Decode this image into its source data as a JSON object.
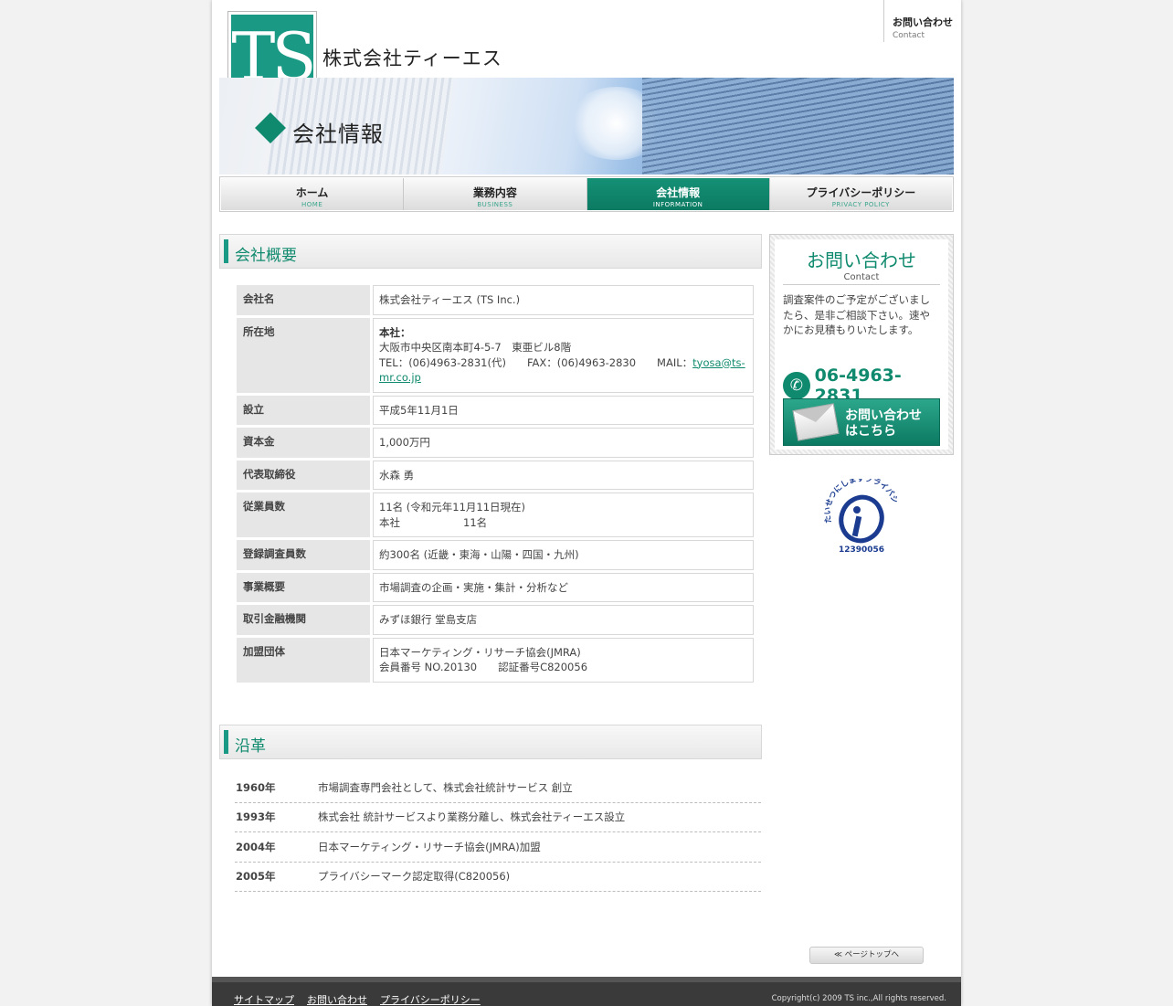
{
  "header": {
    "logo_text": "TS",
    "company_name": "株式会社ティーエス",
    "contact_jp": "お問い合わせ",
    "contact_en": "Contact"
  },
  "banner": {
    "title": "会社情報"
  },
  "nav": [
    {
      "jp": "ホーム",
      "en": "HOME",
      "active": false
    },
    {
      "jp": "業務内容",
      "en": "BUSINESS",
      "active": false
    },
    {
      "jp": "会社情報",
      "en": "INFORMATION",
      "active": true
    },
    {
      "jp": "プライバシーポリシー",
      "en": "PRIVACY POLICY",
      "active": false
    }
  ],
  "overview": {
    "heading": "会社概要",
    "rows": {
      "name": {
        "label": "会社名",
        "value": "株式会社ティーエス (TS Inc.)"
      },
      "address": {
        "label": "所在地",
        "head_office": "本社：",
        "addr": "大阪市中央区南本町4-5-7　東亜ビル8階",
        "tel_fax": "TEL：(06)4963-2831(代)　　FAX：(06)4963-2830　　MAIL：",
        "mail": "tyosa@ts-mr.co.jp"
      },
      "founded": {
        "label": "設立",
        "value": "平成5年11月1日"
      },
      "capital": {
        "label": "資本金",
        "value": "1,000万円"
      },
      "ceo": {
        "label": "代表取締役",
        "value": "水森 勇"
      },
      "employees": {
        "label": "従業員数",
        "line1": "11名 (令和元年11月11日現在)",
        "line2": "本社　　　　　　11名"
      },
      "researchers": {
        "label": "登録調査員数",
        "value": "約300名 (近畿・東海・山陽・四国・九州)"
      },
      "business": {
        "label": "事業概要",
        "value": "市場調査の企画・実施・集計・分析など"
      },
      "bank": {
        "label": "取引金融機関",
        "value": "みずほ銀行 堂島支店"
      },
      "member": {
        "label": "加盟団体",
        "line1": "日本マーケティング・リサーチ協会(JMRA)",
        "line2": "会員番号 NO.20130　　認証番号C820056"
      }
    }
  },
  "history": {
    "heading": "沿革",
    "rows": [
      {
        "year": "1960年",
        "event": "市場調査専門会社として、株式会社統計サービス 創立"
      },
      {
        "year": "1993年",
        "event": "株式会社 統計サービスより業務分離し、株式会社ティーエス設立"
      },
      {
        "year": "2004年",
        "event": "日本マーケティング・リサーチ協会(JMRA)加盟"
      },
      {
        "year": "2005年",
        "event": "プライバシーマーク認定取得(C820056)"
      }
    ]
  },
  "sidebar": {
    "title": "お問い合わせ",
    "title_en": "Contact",
    "message": "調査案件のご予定がございましたら、是非ご相談下さい。速やかにお見積もりいたします。",
    "phone": "06-4963-2831",
    "button_line1": "お問い合わせ",
    "button_line2": "はこちら",
    "pmark_text": "たいせつにしますプライバシー",
    "pmark_code": "12390056"
  },
  "pagetop": "≪ ページトップへ",
  "footer": {
    "links": [
      "サイトマップ",
      "お問い合わせ",
      "プライバシーポリシー"
    ],
    "copyright": "Copyright(c) 2009 TS inc.,All rights reserved."
  },
  "colors": {
    "accent": "#0f8a6e",
    "logo_bg": "#1a9a85",
    "footer_bg": "#3a3a3a"
  }
}
